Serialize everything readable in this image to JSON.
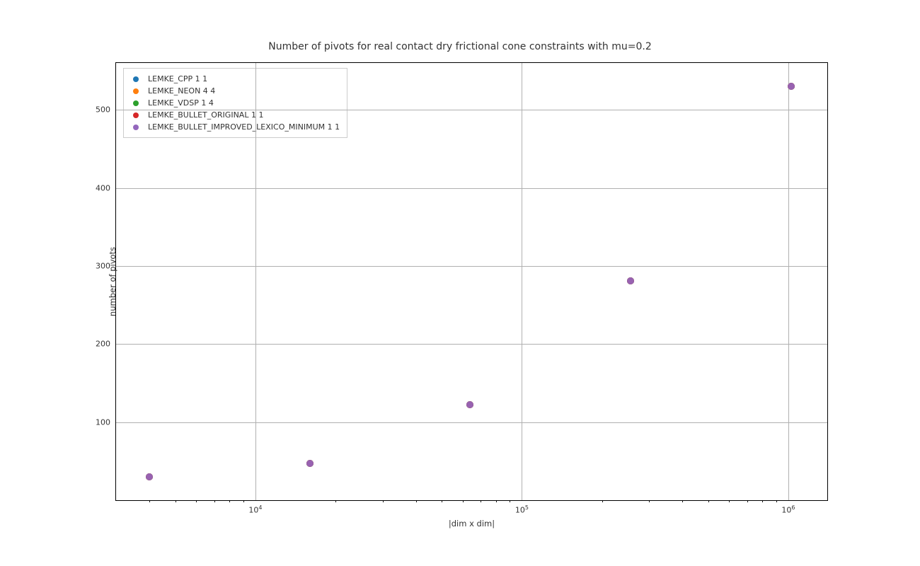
{
  "title": "Number of pivots for real contact dry frictional cone constraints with mu=0.2",
  "xlabel": "|dim x dim|",
  "ylabel": "number of pivots",
  "xticks": {
    "e4": "10",
    "e4_sup": "4",
    "e5": "10",
    "e5_sup": "5",
    "e6": "10",
    "e6_sup": "6"
  },
  "yticks": {
    "y100": "100",
    "y200": "200",
    "y300": "300",
    "y400": "400",
    "y500": "500"
  },
  "legend": {
    "s0": "LEMKE_CPP 1 1",
    "s1": "LEMKE_NEON 4 4",
    "s2": "LEMKE_VDSP 1 4",
    "s3": "LEMKE_BULLET_ORIGINAL 1 1",
    "s4": "LEMKE_BULLET_IMPROVED_LEXICO_MINIMUM 1 1"
  },
  "colors": {
    "s0": "#1f77b4",
    "s1": "#ff7f0e",
    "s2": "#2ca02c",
    "s3": "#d62728",
    "s4": "#9467bd"
  },
  "chart_data": {
    "type": "scatter",
    "title": "Number of pivots for real contact dry frictional cone constraints with mu=0.2",
    "xlabel": "|dim x dim|",
    "ylabel": "number of pivots",
    "xscale": "log",
    "xlim": [
      3000,
      1400000
    ],
    "ylim": [
      0,
      560
    ],
    "grid": true,
    "legend_position": "upper left",
    "x": [
      4000,
      16000,
      64000,
      256000,
      1024000
    ],
    "series": [
      {
        "name": "LEMKE_CPP 1 1",
        "values": [
          30,
          47,
          122,
          281,
          530
        ]
      },
      {
        "name": "LEMKE_NEON 4 4",
        "values": [
          30,
          47,
          122,
          281,
          530
        ]
      },
      {
        "name": "LEMKE_VDSP 1 4",
        "values": [
          30,
          47,
          122,
          281,
          530
        ]
      },
      {
        "name": "LEMKE_BULLET_ORIGINAL 1 1",
        "values": [
          30,
          47,
          122,
          281,
          530
        ]
      },
      {
        "name": "LEMKE_BULLET_IMPROVED_LEXICO_MINIMUM 1 1",
        "values": [
          30,
          47,
          122,
          281,
          530
        ]
      }
    ]
  }
}
